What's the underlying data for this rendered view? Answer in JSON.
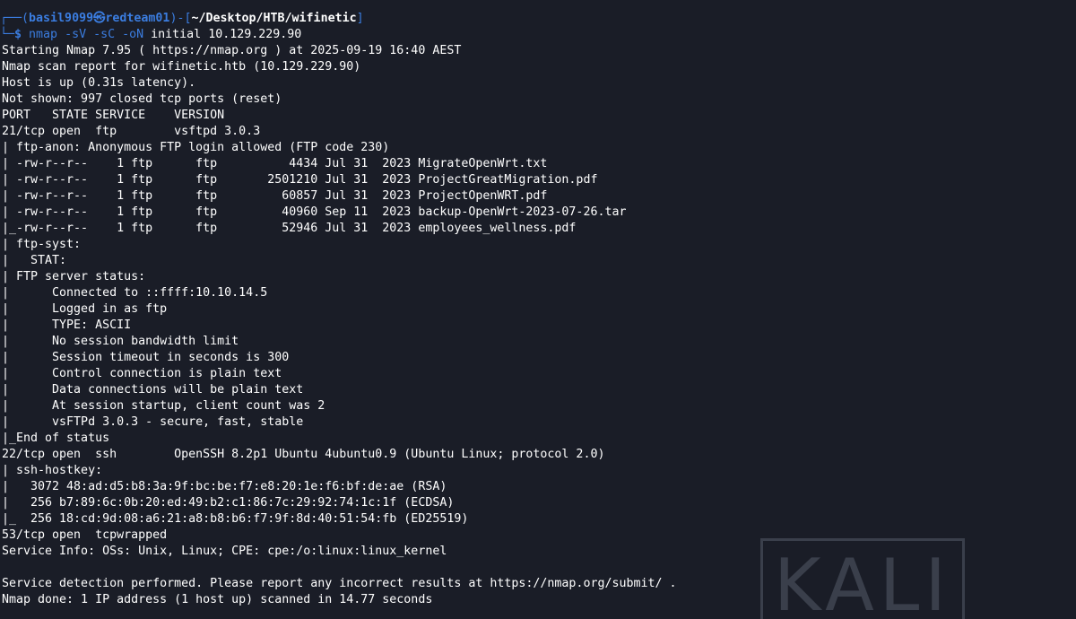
{
  "prompt": {
    "frame_open": "┌──(",
    "user_host": "basil9099㉿redteam01",
    "frame_mid": ")-[",
    "path": "~/Desktop/HTB/wifinetic",
    "frame_close": "]",
    "frame_bottom": "└─",
    "dollar": "$ ",
    "command": "nmap",
    "flags": " -sV -sC -oN",
    "args": " initial 10.129.229.90"
  },
  "output_lines": [
    "Starting Nmap 7.95 ( https://nmap.org ) at 2025-09-19 16:40 AEST",
    "Nmap scan report for wifinetic.htb (10.129.229.90)",
    "Host is up (0.31s latency).",
    "Not shown: 997 closed tcp ports (reset)",
    "PORT   STATE SERVICE    VERSION",
    "21/tcp open  ftp        vsftpd 3.0.3",
    "| ftp-anon: Anonymous FTP login allowed (FTP code 230)",
    "| -rw-r--r--    1 ftp      ftp          4434 Jul 31  2023 MigrateOpenWrt.txt",
    "| -rw-r--r--    1 ftp      ftp       2501210 Jul 31  2023 ProjectGreatMigration.pdf",
    "| -rw-r--r--    1 ftp      ftp         60857 Jul 31  2023 ProjectOpenWRT.pdf",
    "| -rw-r--r--    1 ftp      ftp         40960 Sep 11  2023 backup-OpenWrt-2023-07-26.tar",
    "|_-rw-r--r--    1 ftp      ftp         52946 Jul 31  2023 employees_wellness.pdf",
    "| ftp-syst:",
    "|   STAT:",
    "| FTP server status:",
    "|      Connected to ::ffff:10.10.14.5",
    "|      Logged in as ftp",
    "|      TYPE: ASCII",
    "|      No session bandwidth limit",
    "|      Session timeout in seconds is 300",
    "|      Control connection is plain text",
    "|      Data connections will be plain text",
    "|      At session startup, client count was 2",
    "|      vsFTPd 3.0.3 - secure, fast, stable",
    "|_End of status",
    "22/tcp open  ssh        OpenSSH 8.2p1 Ubuntu 4ubuntu0.9 (Ubuntu Linux; protocol 2.0)",
    "| ssh-hostkey:",
    "|   3072 48:ad:d5:b8:3a:9f:bc:be:f7:e8:20:1e:f6:bf:de:ae (RSA)",
    "|   256 b7:89:6c:0b:20:ed:49:b2:c1:86:7c:29:92:74:1c:1f (ECDSA)",
    "|_  256 18:cd:9d:08:a6:21:a8:b8:b6:f7:9f:8d:40:51:54:fb (ED25519)",
    "53/tcp open  tcpwrapped",
    "Service Info: OSs: Unix, Linux; CPE: cpe:/o:linux:linux_kernel",
    "",
    "Service detection performed. Please report any incorrect results at https://nmap.org/submit/ .",
    "Nmap done: 1 IP address (1 host up) scanned in 14.77 seconds"
  ],
  "watermark": "KALI",
  "colors": {
    "background": "#1a1d27",
    "prompt_accent": "#3b7de0",
    "text": "#ffffff"
  }
}
